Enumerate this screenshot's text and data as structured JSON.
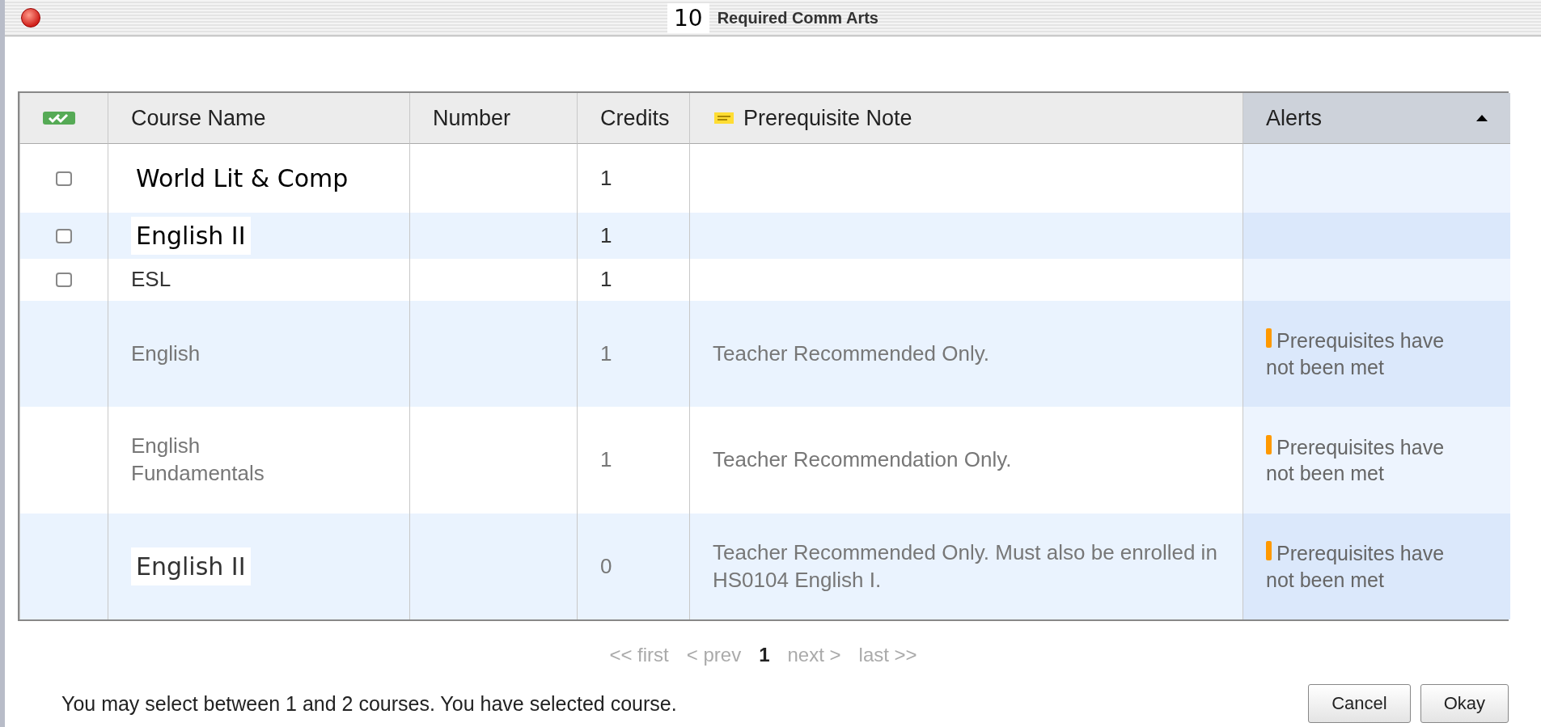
{
  "window": {
    "step": "10",
    "title": "Required Comm Arts"
  },
  "table": {
    "columns": [
      {
        "label": "Course Name",
        "sorted": false
      },
      {
        "label": "Number",
        "sorted": false
      },
      {
        "label": "Credits",
        "sorted": false
      },
      {
        "label": "Prerequisite Note",
        "sorted": false
      },
      {
        "label": "Alerts",
        "sorted": true
      }
    ],
    "rows": [
      {
        "name": "World Lit & Comp",
        "kind": "pasted",
        "credits": "1",
        "checked": false,
        "disabled": false
      },
      {
        "name": "English II",
        "kind": "pasted",
        "credits": "1",
        "checked": false,
        "disabled": false
      },
      {
        "name": "ESL",
        "kind": "plain",
        "credits": "1",
        "checked": false,
        "disabled": false
      },
      {
        "name": "English",
        "kind": "plain",
        "credits": "1",
        "note": "Teacher Recommended Only.",
        "alert": "Prerequisites have not been met",
        "disabled": true
      },
      {
        "name": "English Fundamentals",
        "kind": "plain",
        "credits": "1",
        "note": "Teacher Recommendation Only.",
        "alert": "Prerequisites have not been met",
        "disabled": true
      },
      {
        "name": "English II",
        "kind": "pasted",
        "credits": "0",
        "note": "Teacher Recommended Only. Must also be enrolled in HS0104 English I.",
        "alert": "Prerequisites have not been met",
        "disabled": true
      }
    ]
  },
  "pagination": {
    "first": "<< first",
    "prev": "< prev",
    "page": "1",
    "next": "next >",
    "last": "last >>"
  },
  "status": "You may select between 1 and 2 courses. You have selected  course.",
  "buttons": [
    "Cancel",
    "Okay"
  ]
}
